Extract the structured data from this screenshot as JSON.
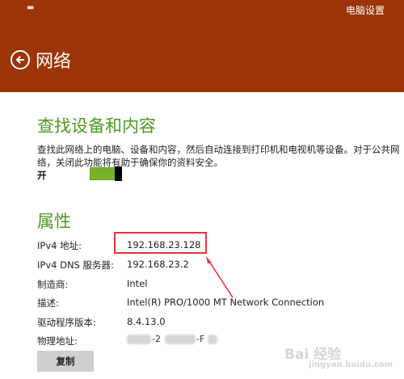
{
  "window": {
    "menu_glyph": "▬",
    "app_title": "电脑设置"
  },
  "header": {
    "back_icon": "arrow-left-circle",
    "title": "网络"
  },
  "discovery": {
    "title": "查找设备和内容",
    "description": "查找此网络上的电脑、设备和内容，然后自动连接到打印机和电视机等设备。对于公共网络，关闭此功能将有助于确保你的资料安全。",
    "toggle_label": "开",
    "toggle_on": true
  },
  "properties": {
    "title": "属性",
    "rows": [
      {
        "label": "IPv4 地址:",
        "value": "192.168.23.128"
      },
      {
        "label": "IPv4 DNS 服务器:",
        "value": "192.168.23.2"
      },
      {
        "label": "制造商:",
        "value": "Intel"
      },
      {
        "label": "描述:",
        "value": "Intel(R) PRO/1000 MT Network Connection"
      },
      {
        "label": "驱动程序版本:",
        "value": "8.4.13.0"
      },
      {
        "label": "物理地址:",
        "value_parts": [
          "-2",
          "-F"
        ]
      }
    ],
    "copy_label": "复制"
  },
  "annotation": {
    "highlight_color": "#e8333a"
  },
  "watermark": {
    "brand": "Bai 经验",
    "sub": "jingyan.baidu.com"
  },
  "colors": {
    "header": "#9c3407",
    "accent": "#4c9a22",
    "toggle": "#77b22a"
  }
}
